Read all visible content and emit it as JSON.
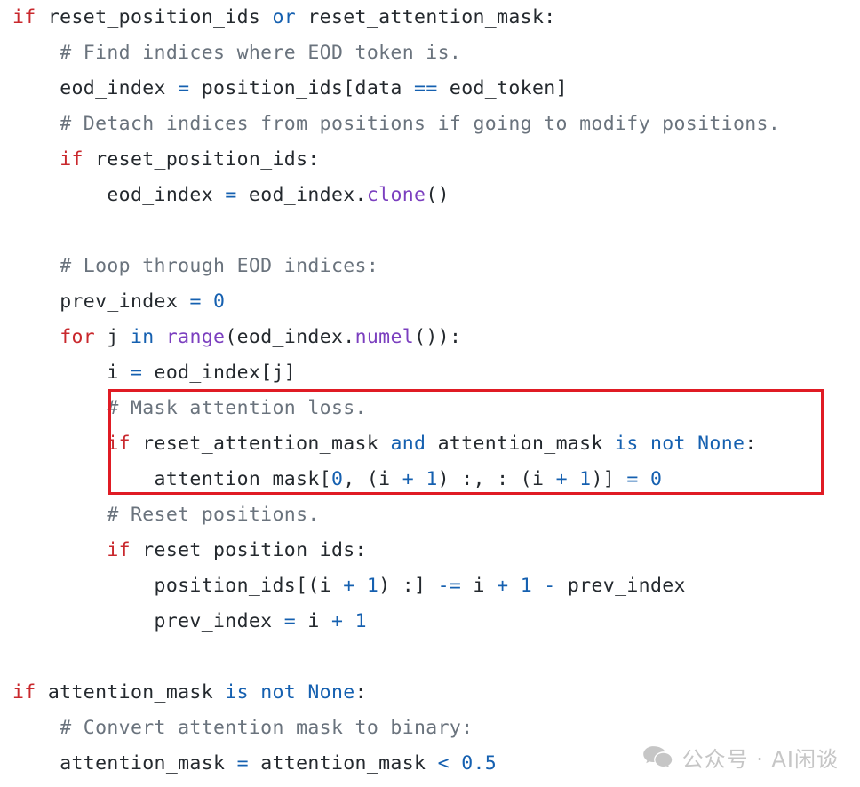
{
  "figure": {
    "kind": "code-screenshot",
    "language": "python",
    "background_color": "#ffffff",
    "highlight_box_color": "#E01B24"
  },
  "colors": {
    "keyword": "#C9282D",
    "operator_keyword": "#1560B0",
    "number": "#1560B0",
    "operator": "#1560B0",
    "builtin_function": "#7B3FBF",
    "comment": "#6A737D",
    "plain_text": "#24292e"
  },
  "code": {
    "lines": [
      {
        "id": "line-1",
        "indent": 0,
        "tokens": [
          {
            "t": "if",
            "c": "kw"
          },
          {
            "t": " reset_position_ids ",
            "c": "txt"
          },
          {
            "t": "or",
            "c": "op-kw"
          },
          {
            "t": " reset_attention_mask:",
            "c": "txt"
          }
        ]
      },
      {
        "id": "line-2",
        "indent": 1,
        "tokens": [
          {
            "t": "# Find indices where EOD token is.",
            "c": "cmt"
          }
        ]
      },
      {
        "id": "line-3",
        "indent": 1,
        "tokens": [
          {
            "t": "eod_index ",
            "c": "txt"
          },
          {
            "t": "=",
            "c": "op"
          },
          {
            "t": " position_ids[data ",
            "c": "txt"
          },
          {
            "t": "==",
            "c": "op"
          },
          {
            "t": " eod_token]",
            "c": "txt"
          }
        ]
      },
      {
        "id": "line-4",
        "indent": 1,
        "tokens": [
          {
            "t": "# Detach indices from positions if going to modify positions.",
            "c": "cmt"
          }
        ]
      },
      {
        "id": "line-5",
        "indent": 1,
        "tokens": [
          {
            "t": "if",
            "c": "kw"
          },
          {
            "t": " reset_position_ids:",
            "c": "txt"
          }
        ]
      },
      {
        "id": "line-6",
        "indent": 2,
        "tokens": [
          {
            "t": "eod_index ",
            "c": "txt"
          },
          {
            "t": "=",
            "c": "op"
          },
          {
            "t": " eod_index.",
            "c": "txt"
          },
          {
            "t": "clone",
            "c": "fn"
          },
          {
            "t": "()",
            "c": "txt"
          }
        ]
      },
      {
        "id": "line-7",
        "indent": 0,
        "tokens": []
      },
      {
        "id": "line-8",
        "indent": 1,
        "tokens": [
          {
            "t": "# Loop through EOD indices:",
            "c": "cmt"
          }
        ]
      },
      {
        "id": "line-9",
        "indent": 1,
        "tokens": [
          {
            "t": "prev_index ",
            "c": "txt"
          },
          {
            "t": "=",
            "c": "op"
          },
          {
            "t": " ",
            "c": "txt"
          },
          {
            "t": "0",
            "c": "num"
          }
        ]
      },
      {
        "id": "line-10",
        "indent": 1,
        "tokens": [
          {
            "t": "for",
            "c": "kw"
          },
          {
            "t": " j ",
            "c": "txt"
          },
          {
            "t": "in",
            "c": "op-kw"
          },
          {
            "t": " ",
            "c": "txt"
          },
          {
            "t": "range",
            "c": "fn"
          },
          {
            "t": "(eod_index.",
            "c": "txt"
          },
          {
            "t": "numel",
            "c": "fn"
          },
          {
            "t": "()):",
            "c": "txt"
          }
        ]
      },
      {
        "id": "line-11",
        "indent": 2,
        "tokens": [
          {
            "t": "i ",
            "c": "txt"
          },
          {
            "t": "=",
            "c": "op"
          },
          {
            "t": " eod_index[j]",
            "c": "txt"
          }
        ]
      },
      {
        "id": "line-12",
        "indent": 2,
        "highlighted": true,
        "tokens": [
          {
            "t": "# Mask attention loss.",
            "c": "cmt"
          }
        ]
      },
      {
        "id": "line-13",
        "indent": 2,
        "highlighted": true,
        "tokens": [
          {
            "t": "if",
            "c": "kw"
          },
          {
            "t": " reset_attention_mask ",
            "c": "txt"
          },
          {
            "t": "and",
            "c": "op-kw"
          },
          {
            "t": " attention_mask ",
            "c": "txt"
          },
          {
            "t": "is",
            "c": "op-kw"
          },
          {
            "t": " ",
            "c": "txt"
          },
          {
            "t": "not",
            "c": "op-kw"
          },
          {
            "t": " ",
            "c": "txt"
          },
          {
            "t": "None",
            "c": "op-kw"
          },
          {
            "t": ":",
            "c": "txt"
          }
        ]
      },
      {
        "id": "line-14",
        "indent": 3,
        "highlighted": true,
        "tokens": [
          {
            "t": "attention_mask[",
            "c": "txt"
          },
          {
            "t": "0",
            "c": "num"
          },
          {
            "t": ", (i ",
            "c": "txt"
          },
          {
            "t": "+",
            "c": "op"
          },
          {
            "t": " ",
            "c": "txt"
          },
          {
            "t": "1",
            "c": "num"
          },
          {
            "t": ") :, : (i ",
            "c": "txt"
          },
          {
            "t": "+",
            "c": "op"
          },
          {
            "t": " ",
            "c": "txt"
          },
          {
            "t": "1",
            "c": "num"
          },
          {
            "t": ")] ",
            "c": "txt"
          },
          {
            "t": "=",
            "c": "op"
          },
          {
            "t": " ",
            "c": "txt"
          },
          {
            "t": "0",
            "c": "num"
          }
        ]
      },
      {
        "id": "line-15",
        "indent": 2,
        "tokens": [
          {
            "t": "# Reset positions.",
            "c": "cmt"
          }
        ]
      },
      {
        "id": "line-16",
        "indent": 2,
        "tokens": [
          {
            "t": "if",
            "c": "kw"
          },
          {
            "t": " reset_position_ids:",
            "c": "txt"
          }
        ]
      },
      {
        "id": "line-17",
        "indent": 3,
        "tokens": [
          {
            "t": "position_ids[(i ",
            "c": "txt"
          },
          {
            "t": "+",
            "c": "op"
          },
          {
            "t": " ",
            "c": "txt"
          },
          {
            "t": "1",
            "c": "num"
          },
          {
            "t": ") :] ",
            "c": "txt"
          },
          {
            "t": "-=",
            "c": "op"
          },
          {
            "t": " i ",
            "c": "txt"
          },
          {
            "t": "+",
            "c": "op"
          },
          {
            "t": " ",
            "c": "txt"
          },
          {
            "t": "1",
            "c": "num"
          },
          {
            "t": " ",
            "c": "txt"
          },
          {
            "t": "-",
            "c": "op"
          },
          {
            "t": " prev_index",
            "c": "txt"
          }
        ]
      },
      {
        "id": "line-18",
        "indent": 3,
        "tokens": [
          {
            "t": "prev_index ",
            "c": "txt"
          },
          {
            "t": "=",
            "c": "op"
          },
          {
            "t": " i ",
            "c": "txt"
          },
          {
            "t": "+",
            "c": "op"
          },
          {
            "t": " ",
            "c": "txt"
          },
          {
            "t": "1",
            "c": "num"
          }
        ]
      },
      {
        "id": "line-19",
        "indent": 0,
        "tokens": []
      },
      {
        "id": "line-20",
        "indent": 0,
        "tokens": [
          {
            "t": "if",
            "c": "kw"
          },
          {
            "t": " attention_mask ",
            "c": "txt"
          },
          {
            "t": "is",
            "c": "op-kw"
          },
          {
            "t": " ",
            "c": "txt"
          },
          {
            "t": "not",
            "c": "op-kw"
          },
          {
            "t": " ",
            "c": "txt"
          },
          {
            "t": "None",
            "c": "op-kw"
          },
          {
            "t": ":",
            "c": "txt"
          }
        ]
      },
      {
        "id": "line-21",
        "indent": 1,
        "tokens": [
          {
            "t": "# Convert attention mask to binary:",
            "c": "cmt"
          }
        ]
      },
      {
        "id": "line-22",
        "indent": 1,
        "tokens": [
          {
            "t": "attention_mask ",
            "c": "txt"
          },
          {
            "t": "=",
            "c": "op"
          },
          {
            "t": " attention_mask ",
            "c": "txt"
          },
          {
            "t": "<",
            "c": "op"
          },
          {
            "t": " ",
            "c": "txt"
          },
          {
            "t": "0.5",
            "c": "num"
          }
        ]
      }
    ],
    "plain_text": "if reset_position_ids or reset_attention_mask:\n    # Find indices where EOD token is.\n    eod_index = position_ids[data == eod_token]\n    # Detach indices from positions if going to modify positions.\n    if reset_position_ids:\n        eod_index = eod_index.clone()\n\n    # Loop through EOD indices:\n    prev_index = 0\n    for j in range(eod_index.numel()):\n        i = eod_index[j]\n        # Mask attention loss.\n        if reset_attention_mask and attention_mask is not None:\n            attention_mask[0, (i + 1) :, : (i + 1)] = 0\n        # Reset positions.\n        if reset_position_ids:\n            position_ids[(i + 1) :] -= i + 1 - prev_index\n            prev_index = i + 1\n\nif attention_mask is not None:\n    # Convert attention mask to binary:\n    attention_mask = attention_mask < 0.5"
  },
  "watermark": {
    "icon": "wechat-logo-icon",
    "text": "公众号 · AI闲谈",
    "color": "#C6C6C6"
  }
}
